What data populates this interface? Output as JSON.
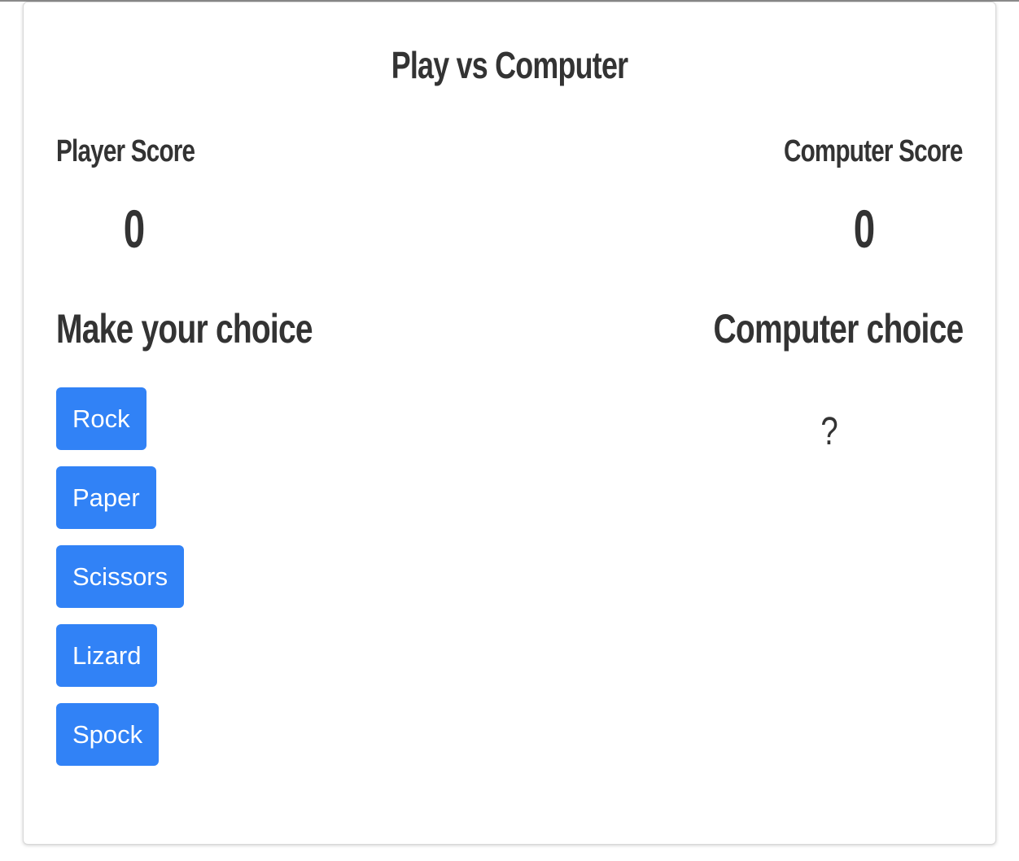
{
  "game": {
    "title": "Play vs Computer",
    "player_score_label": "Player Score",
    "player_score": "0",
    "computer_score_label": "Computer Score",
    "computer_score": "0",
    "player_choice_heading": "Make your choice",
    "computer_choice_heading": "Computer choice",
    "computer_choice_value": "?",
    "choices": [
      "Rock",
      "Paper",
      "Scissors",
      "Lizard",
      "Spock"
    ]
  },
  "colors": {
    "button_bg": "#3182f6",
    "button_text": "#ffffff",
    "text": "#333333"
  }
}
